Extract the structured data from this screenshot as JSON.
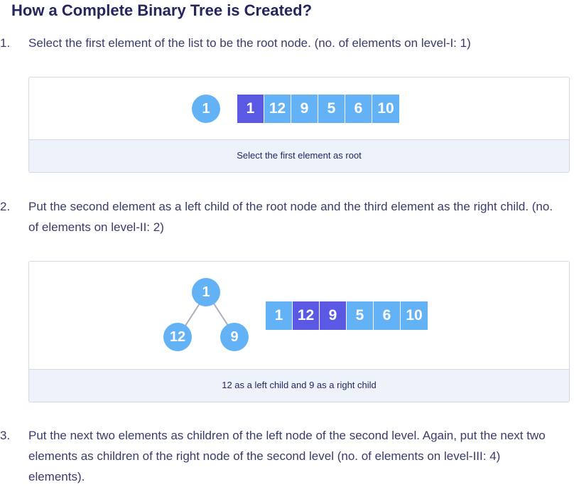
{
  "page": {
    "title": "How a Complete Binary Tree is Created?"
  },
  "steps": [
    {
      "number": "1.",
      "text": "Select the first element of the list to be the root node. (no. of elements on level-I: 1)"
    },
    {
      "number": "2.",
      "text": "Put the second element as a left child of the root node and the third element as the right child. (no. of elements on level-II: 2)"
    },
    {
      "number": "3.",
      "text": "Put the next two elements as children of the left node of the second level. Again, put the next two elements as children of the right node of the second level (no. of elements on level-III: 4) elements)."
    }
  ],
  "figure1": {
    "root_node": "1",
    "array": [
      "1",
      "12",
      "9",
      "5",
      "6",
      "10"
    ],
    "highlighted_index": [
      0
    ],
    "caption": "Select the first element as root"
  },
  "figure2": {
    "root_node": "1",
    "left_child": "12",
    "right_child": "9",
    "array": [
      "1",
      "12",
      "9",
      "5",
      "6",
      "10"
    ],
    "highlighted_index": [
      1,
      2
    ],
    "caption": "12 as a left child and 9 as a right child"
  },
  "colors": {
    "node": "#63b2f6",
    "cell": "#63b2f6",
    "highlight": "#5b59e3",
    "caption_bg": "#eef2fb",
    "border": "#d3d8e6",
    "text": "#25265e",
    "edge": "#a9aebd"
  }
}
